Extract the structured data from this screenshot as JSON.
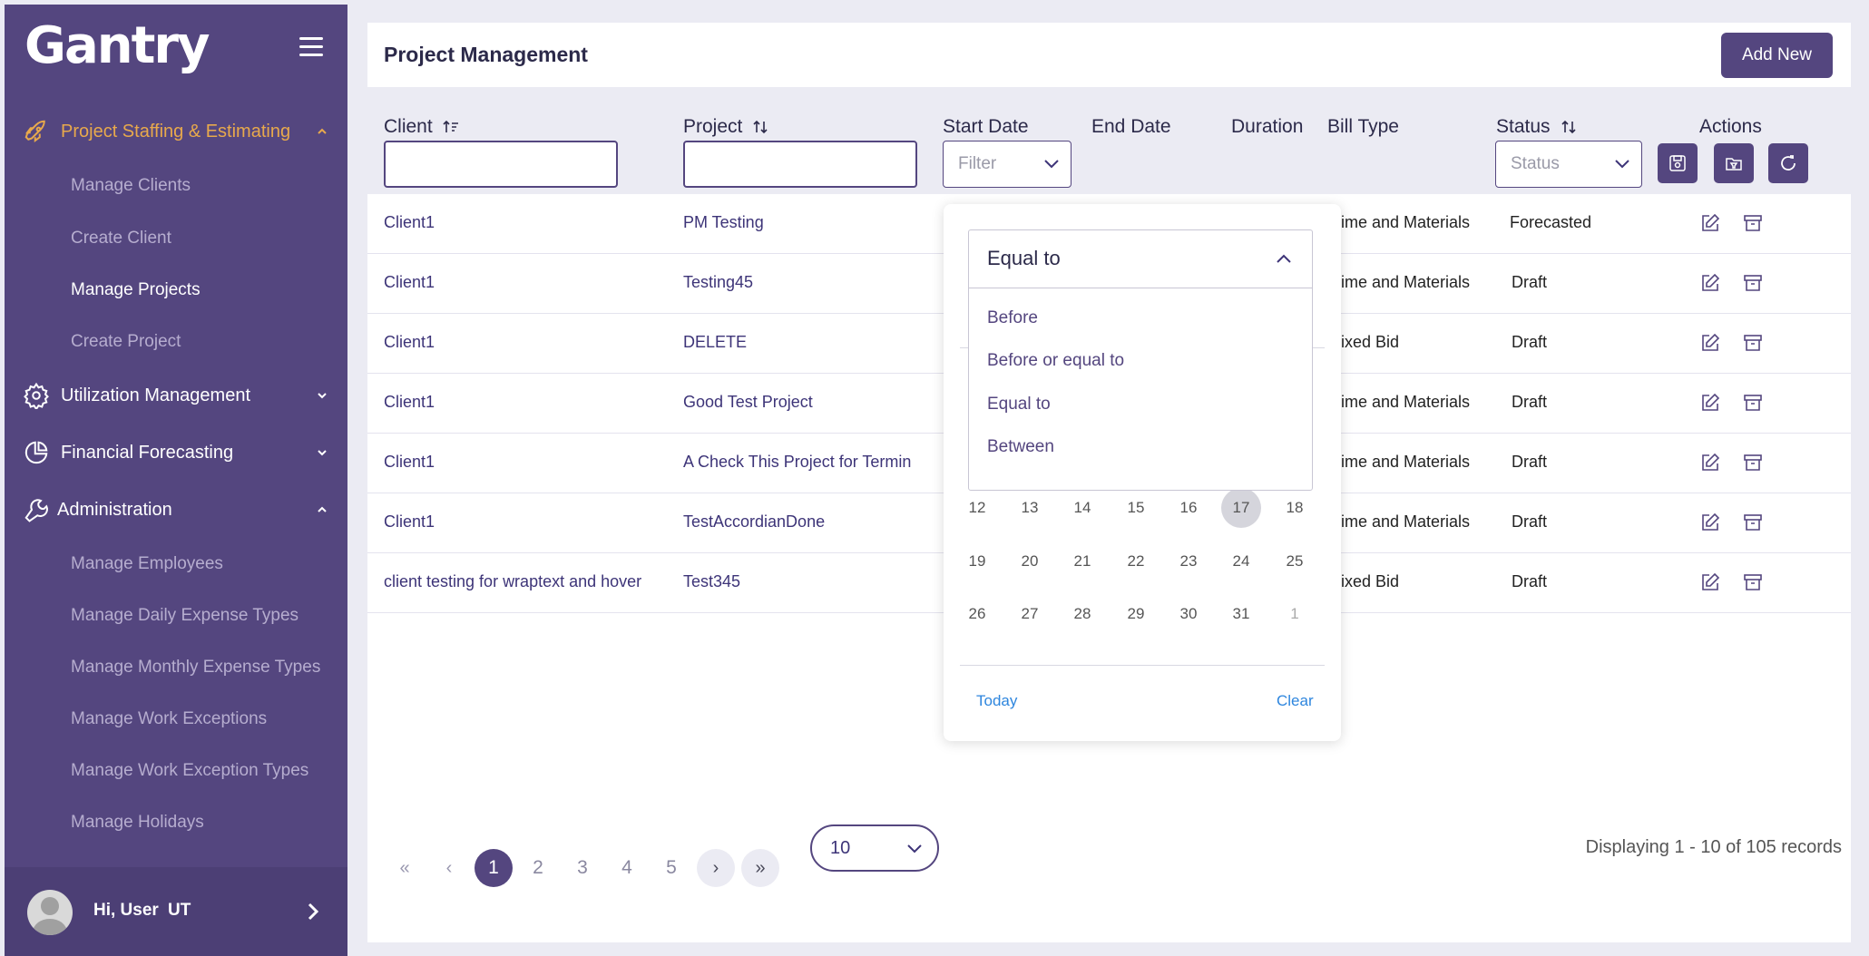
{
  "app": {
    "logo": "Gantry"
  },
  "sidebar": {
    "sections": [
      {
        "label": "Project Staffing & Estimating",
        "expanded": true,
        "active": true,
        "items": [
          "Manage Clients",
          "Create Client",
          "Manage Projects",
          "Create Project"
        ]
      },
      {
        "label": "Utilization Management",
        "expanded": false
      },
      {
        "label": "Financial Forecasting",
        "expanded": false
      },
      {
        "label": "Administration",
        "expanded": true,
        "items": [
          "Manage Employees",
          "Manage Daily Expense Types",
          "Manage Monthly Expense Types",
          "Manage Work Exceptions",
          "Manage Work Exception Types",
          "Manage Holidays"
        ]
      }
    ],
    "current_item": "Manage Projects",
    "user": {
      "greeting": "Hi, User",
      "initials": "UT"
    }
  },
  "main": {
    "title": "Project Management",
    "add_button": "Add New",
    "columns": [
      "Client",
      "Project",
      "Start Date",
      "End Date",
      "Duration",
      "Bill Type",
      "Status",
      "Actions"
    ],
    "filters": {
      "start_date_placeholder": "Filter",
      "status_placeholder": "Status"
    },
    "rows": [
      {
        "client": "Client1",
        "project": "PM Testing",
        "bill_type": "ime and Materials",
        "status": "Forecasted"
      },
      {
        "client": "Client1",
        "project": "Testing45",
        "bill_type": "ime and Materials",
        "status": "Draft"
      },
      {
        "client": "Client1",
        "project": "DELETE",
        "bill_type": "ixed Bid",
        "status": "Draft"
      },
      {
        "client": "Client1",
        "project": "Good Test Project",
        "bill_type": "ime and Materials",
        "status": "Draft"
      },
      {
        "client": "Client1",
        "project": "A Check This Project for Termin",
        "bill_type": "ime and Materials",
        "status": "Draft"
      },
      {
        "client": "Client1",
        "project": "TestAccordianDone",
        "bill_type": "ime and Materials",
        "status": "Draft"
      },
      {
        "client": "client testing for wraptext and hover",
        "project": "Test345",
        "bill_type": "ixed Bid",
        "status": "Draft"
      }
    ],
    "pagination": {
      "pages": [
        "1",
        "2",
        "3",
        "4",
        "5"
      ],
      "current_page": "1",
      "per_page": "10",
      "summary": "Displaying 1 - 10 of 105 records"
    }
  },
  "date_filter_popup": {
    "operator_selected": "Equal to",
    "operator_options": [
      "Before",
      "Before or equal to",
      "Equal to",
      "Between"
    ],
    "calendar_rows": [
      [
        "12",
        "13",
        "14",
        "15",
        "16",
        "17",
        "18"
      ],
      [
        "19",
        "20",
        "21",
        "22",
        "23",
        "24",
        "25"
      ],
      [
        "26",
        "27",
        "28",
        "29",
        "30",
        "31",
        "1"
      ]
    ],
    "selected_day": "17",
    "today_label": "Today",
    "clear_label": "Clear"
  },
  "colors": {
    "sidebar": "#54467f",
    "accent": "#e8a94c",
    "primary": "#54467f",
    "link": "#2e86de"
  }
}
